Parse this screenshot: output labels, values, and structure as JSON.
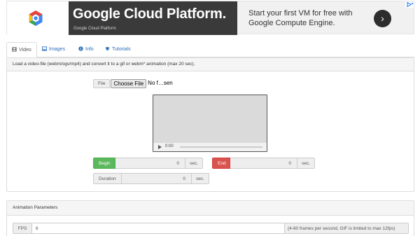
{
  "ad": {
    "title": "Google Cloud Platform.",
    "subtitle": "Google Cloud Platform",
    "line1": "Start your first VM for free with",
    "line2": "Google Compute Engine.",
    "cta_icon": "chevron-right-icon",
    "colors": {
      "logo_red": "#ea4335",
      "logo_blue": "#4285f4",
      "logo_yellow": "#fbbc05",
      "dark_bg": "#3a3a3a"
    }
  },
  "tabs": [
    {
      "label": "Video",
      "icon": "film-icon",
      "active": true
    },
    {
      "label": "Images",
      "icon": "picture-icon",
      "active": false
    },
    {
      "label": "Info",
      "icon": "info-icon",
      "active": false
    },
    {
      "label": "Tutorials",
      "icon": "graduation-cap-icon",
      "active": false
    }
  ],
  "video_panel": {
    "heading": "Load a video-file (webm/ogv/mp4) and convert it to a gif or webm* animation (max 20 sec).",
    "file_label": "File",
    "choose_button": "Choose File",
    "no_file_text": "No f…sen",
    "player_time": "0:00",
    "begin": {
      "label": "Begin",
      "value": "0",
      "unit": "sec.",
      "color": "#5cb85c"
    },
    "end": {
      "label": "End",
      "value": "0",
      "unit": "sec.",
      "color": "#d9534f"
    },
    "duration": {
      "label": "Duration",
      "value": "0",
      "unit": "sec."
    }
  },
  "animation_panel": {
    "heading": "Animation Parameters",
    "fps_label": "FPS",
    "fps_value": "6",
    "fps_hint": "(4-60 frames per second, GIF is limited to max 12fps)"
  }
}
